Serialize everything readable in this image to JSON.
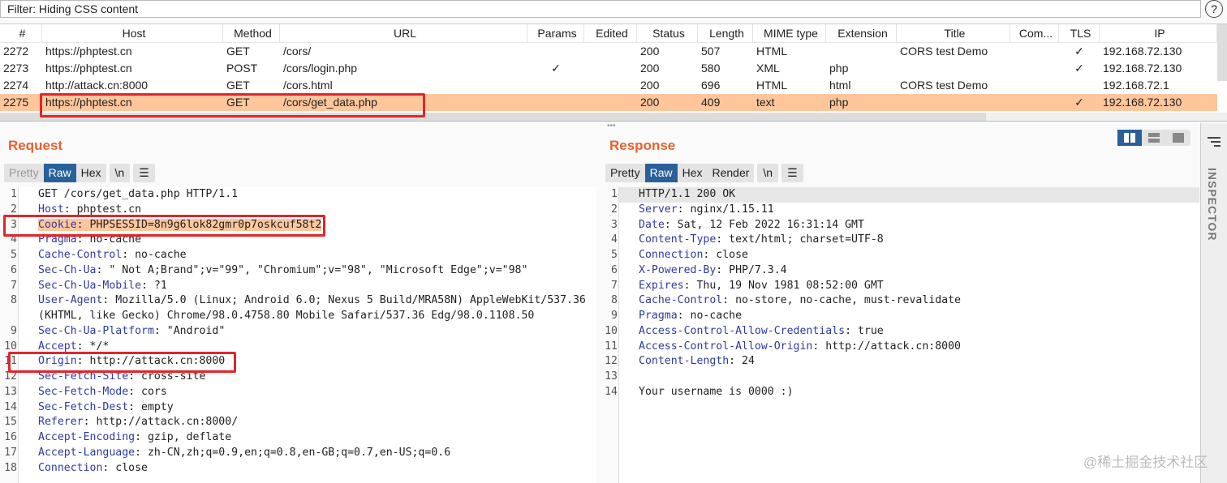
{
  "filter": {
    "text": "Filter: Hiding CSS content",
    "help": "?"
  },
  "table": {
    "columns": [
      "#",
      "Host",
      "Method",
      "URL",
      "Params",
      "Edited",
      "Status",
      "Length",
      "MIME type",
      "Extension",
      "Title",
      "Com...",
      "TLS",
      "IP"
    ],
    "rows": [
      {
        "id": "2272",
        "host": "https://phptest.cn",
        "method": "GET",
        "url": "/cors/",
        "params": "",
        "edited": "",
        "status": "200",
        "length": "507",
        "mime": "HTML",
        "ext": "",
        "title": "CORS test Demo",
        "com": "",
        "tls": "✓",
        "ip": "192.168.72.130",
        "selected": false
      },
      {
        "id": "2273",
        "host": "https://phptest.cn",
        "method": "POST",
        "url": "/cors/login.php",
        "params": "✓",
        "edited": "",
        "status": "200",
        "length": "580",
        "mime": "XML",
        "ext": "php",
        "title": "",
        "com": "",
        "tls": "✓",
        "ip": "192.168.72.130",
        "selected": false
      },
      {
        "id": "2274",
        "host": "http://attack.cn:8000",
        "method": "GET",
        "url": "/cors.html",
        "params": "",
        "edited": "",
        "status": "200",
        "length": "696",
        "mime": "HTML",
        "ext": "html",
        "title": "CORS test Demo",
        "com": "",
        "tls": "",
        "ip": "192.168.72.1",
        "selected": false
      },
      {
        "id": "2275",
        "host": "https://phptest.cn",
        "method": "GET",
        "url": "/cors/get_data.php",
        "params": "",
        "edited": "",
        "status": "200",
        "length": "409",
        "mime": "text",
        "ext": "php",
        "title": "",
        "com": "",
        "tls": "✓",
        "ip": "192.168.72.130",
        "selected": true
      }
    ]
  },
  "request": {
    "title": "Request",
    "tabs": [
      "Pretty",
      "Raw",
      "Hex"
    ],
    "active_tab": "Raw",
    "newline_btn": "\\n",
    "menu_btn": "☰",
    "lines": [
      {
        "n": "1",
        "name": "",
        "value": "GET /cors/get_data.php HTTP/1.1"
      },
      {
        "n": "2",
        "name": "Host",
        "value": ": phptest.cn"
      },
      {
        "n": "3",
        "name": "Cookie",
        "value": ": PHPSESSID=8n9g6lok82gmr0p7oskcuf58t2",
        "highlight": true
      },
      {
        "n": "4",
        "name": "Pragma",
        "value": ": no-cache"
      },
      {
        "n": "5",
        "name": "Cache-Control",
        "value": ": no-cache"
      },
      {
        "n": "6",
        "name": "Sec-Ch-Ua",
        "value": ": \" Not A;Brand\";v=\"99\", \"Chromium\";v=\"98\", \"Microsoft Edge\";v=\"98\""
      },
      {
        "n": "7",
        "name": "Sec-Ch-Ua-Mobile",
        "value": ": ?1"
      },
      {
        "n": "8",
        "name": "User-Agent",
        "value": ": Mozilla/5.0 (Linux; Android 6.0; Nexus 5 Build/MRA58N) AppleWebKit/537.36"
      },
      {
        "n": "",
        "name": "",
        "value": "(KHTML, like Gecko) Chrome/98.0.4758.80 Mobile Safari/537.36 Edg/98.0.1108.50"
      },
      {
        "n": "9",
        "name": "Sec-Ch-Ua-Platform",
        "value": ": \"Android\""
      },
      {
        "n": "10",
        "name": "Accept",
        "value": ": */*"
      },
      {
        "n": "11",
        "name": "Origin",
        "value": ": http://attack.cn:8000"
      },
      {
        "n": "12",
        "name": "Sec-Fetch-Site",
        "value": ": cross-site"
      },
      {
        "n": "13",
        "name": "Sec-Fetch-Mode",
        "value": ": cors"
      },
      {
        "n": "14",
        "name": "Sec-Fetch-Dest",
        "value": ": empty"
      },
      {
        "n": "15",
        "name": "Referer",
        "value": ": http://attack.cn:8000/"
      },
      {
        "n": "16",
        "name": "Accept-Encoding",
        "value": ": gzip, deflate"
      },
      {
        "n": "17",
        "name": "Accept-Language",
        "value": ": zh-CN,zh;q=0.9,en;q=0.8,en-GB;q=0.7,en-US;q=0.6"
      },
      {
        "n": "18",
        "name": "Connection",
        "value": ": close"
      }
    ]
  },
  "response": {
    "title": "Response",
    "tabs": [
      "Pretty",
      "Raw",
      "Hex",
      "Render"
    ],
    "active_tab": "Raw",
    "newline_btn": "\\n",
    "menu_btn": "☰",
    "lines": [
      {
        "n": "1",
        "name": "",
        "value": "HTTP/1.1 200 OK",
        "current": true
      },
      {
        "n": "2",
        "name": "Server",
        "value": ": nginx/1.15.11"
      },
      {
        "n": "3",
        "name": "Date",
        "value": ": Sat, 12 Feb 2022 16:31:14 GMT"
      },
      {
        "n": "4",
        "name": "Content-Type",
        "value": ": text/html; charset=UTF-8"
      },
      {
        "n": "5",
        "name": "Connection",
        "value": ": close"
      },
      {
        "n": "6",
        "name": "X-Powered-By",
        "value": ": PHP/7.3.4"
      },
      {
        "n": "7",
        "name": "Expires",
        "value": ": Thu, 19 Nov 1981 08:52:00 GMT"
      },
      {
        "n": "8",
        "name": "Cache-Control",
        "value": ": no-store, no-cache, must-revalidate"
      },
      {
        "n": "9",
        "name": "Pragma",
        "value": ": no-cache"
      },
      {
        "n": "10",
        "name": "Access-Control-Allow-Credentials",
        "value": ": true"
      },
      {
        "n": "11",
        "name": "Access-Control-Allow-Origin",
        "value": ": http://attack.cn:8000"
      },
      {
        "n": "12",
        "name": "Content-Length",
        "value": ": 24"
      },
      {
        "n": "13",
        "name": "",
        "value": ""
      },
      {
        "n": "14",
        "name": "",
        "value": "Your username is 0000 :)"
      }
    ]
  },
  "inspector": {
    "label": "INSPECTOR"
  },
  "watermark": "@稀土掘金技术社区",
  "colors": {
    "accent": "#e8612c",
    "selected_row": "#ffc69c",
    "active_tab": "#2a6099",
    "header_name": "#2f3aa0",
    "annotation": "#e1252a"
  }
}
